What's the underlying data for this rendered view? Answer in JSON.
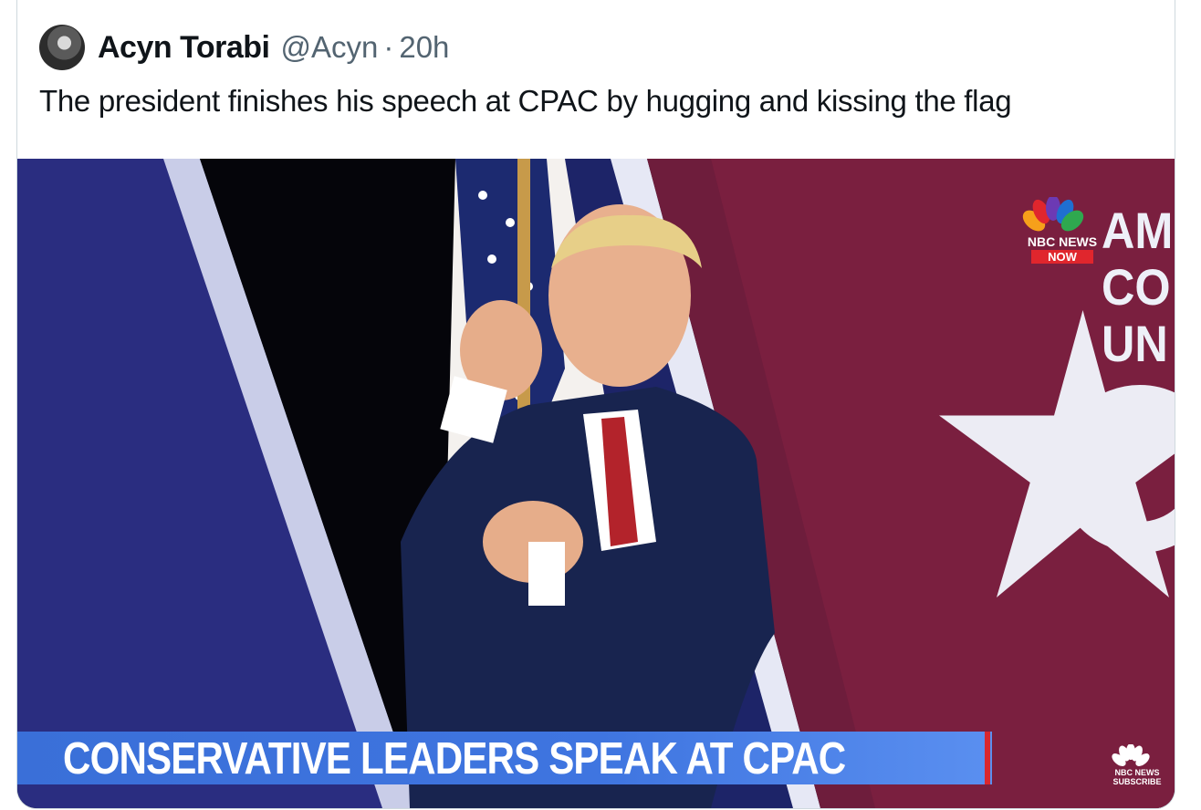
{
  "tweet": {
    "author_name": "Acyn Torabi",
    "handle": "@Acyn",
    "separator": "·",
    "time": "20h",
    "text": "The president finishes his speech at CPAC by hugging and kissing the flag"
  },
  "media": {
    "chyron": "CONSERVATIVE LEADERS SPEAK AT CPAC",
    "logo_network": "NBC NEWS",
    "logo_sub": "NOW",
    "corner_logo_line1": "NBC NEWS",
    "corner_logo_line2": "SUBSCRIBE",
    "backdrop_letters": [
      "AM",
      "CO",
      "UN"
    ],
    "colors": {
      "chyron_blue": "#3f75e0",
      "backdrop_maroon": "#7a1f3f",
      "accent_red": "#e0262d"
    }
  }
}
